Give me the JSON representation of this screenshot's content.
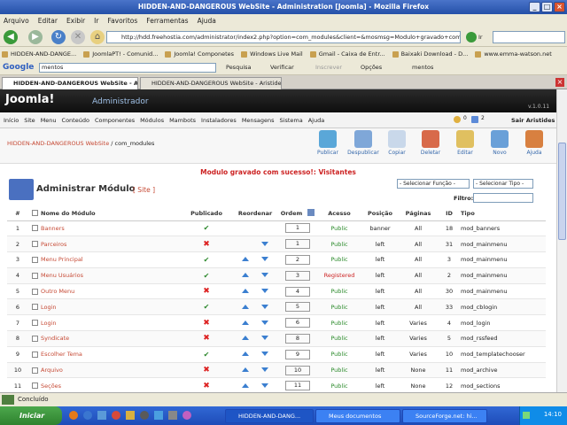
{
  "window": {
    "title": "HIDDEN-AND-DANGEROUS WebSite - Administration [Joomla] - Mozilla Firefox"
  },
  "menubar": [
    "Arquivo",
    "Editar",
    "Exibir",
    "Ir",
    "Favoritos",
    "Ferramentas",
    "Ajuda"
  ],
  "url": "http://hdd.freehostia.com/administrator/index2.php?option=com_modules&client=&mosmsg=Modulo+gravado+com+suce",
  "go_label": "Ir",
  "bookmarks": [
    "HIDDEN-AND-DANGE...",
    "JoomlaPT! - Comunid...",
    "Joomla! Componetes",
    "Windows Live Mail",
    "Gmail - Caixa de Entr...",
    "Baixaki Download - D...",
    "www.emma-watson.net"
  ],
  "google": {
    "label": "Google",
    "query": "mentos",
    "pesquisa": "Pesquisa",
    "verificar": "Verificar",
    "inscrever": "Inscrever",
    "opcoes": "Opções",
    "extra": "mentos"
  },
  "tabs": [
    "HIDDEN-AND-DANGEROUS WebSite - A...",
    "HIDDEN-AND-DANGEROUS WebSite - Aristides"
  ],
  "joomla": {
    "logo": "Joomla!",
    "subtitle": "Administrador",
    "version": "v.1.0.11",
    "user": "Sair Aristides",
    "counter1": "0",
    "counter2": "2"
  },
  "jmenu": [
    "Início",
    "Site",
    "Menu",
    "Conteúdo",
    "Componentes",
    "Módulos",
    "Mambots",
    "Instaladores",
    "Mensagens",
    "Sistema",
    "Ajuda"
  ],
  "breadcrumb": {
    "site": "HIDDEN-AND-DANGEROUS WebSite",
    "path": " / com_modules"
  },
  "toolbar": [
    "Publicar",
    "Despublicar",
    "Copiar",
    "Deletar",
    "Editar",
    "Novo",
    "Ajuda"
  ],
  "message": "Modulo gravado com sucesso!: Visitantes",
  "heading": {
    "title": "Administrar Módulo",
    "sub": "[ Site ]"
  },
  "filters": {
    "funcao": "- Selecionar Função -",
    "tipo": "- Selecionar Tipo -",
    "filtro_label": "Filtro:"
  },
  "columns": [
    "#",
    "",
    "Nome do Módulo",
    "Publicado",
    "Reordenar",
    "Ordem",
    "",
    "Acesso",
    "Posição",
    "Páginas",
    "ID",
    "Tipo"
  ],
  "rows": [
    {
      "n": "1",
      "name": "Banners",
      "pub": true,
      "up": false,
      "down": false,
      "order": "1",
      "access": "Public",
      "pos": "banner",
      "pages": "All",
      "id": "18",
      "type": "mod_banners"
    },
    {
      "n": "2",
      "name": "Parceiros",
      "pub": false,
      "up": false,
      "down": true,
      "order": "1",
      "access": "Public",
      "pos": "left",
      "pages": "All",
      "id": "31",
      "type": "mod_mainmenu"
    },
    {
      "n": "3",
      "name": "Menu Principal",
      "pub": true,
      "up": true,
      "down": true,
      "order": "2",
      "access": "Public",
      "pos": "left",
      "pages": "All",
      "id": "3",
      "type": "mod_mainmenu"
    },
    {
      "n": "4",
      "name": "Menu Usuários",
      "pub": true,
      "up": true,
      "down": true,
      "order": "3",
      "access": "Registered",
      "pos": "left",
      "pages": "All",
      "id": "2",
      "type": "mod_mainmenu"
    },
    {
      "n": "5",
      "name": "Outro Menu",
      "pub": false,
      "up": true,
      "down": true,
      "order": "4",
      "access": "Public",
      "pos": "left",
      "pages": "All",
      "id": "30",
      "type": "mod_mainmenu"
    },
    {
      "n": "6",
      "name": "Login",
      "pub": true,
      "up": true,
      "down": true,
      "order": "5",
      "access": "Public",
      "pos": "left",
      "pages": "All",
      "id": "33",
      "type": "mod_cblogin"
    },
    {
      "n": "7",
      "name": "Login",
      "pub": false,
      "up": true,
      "down": true,
      "order": "6",
      "access": "Public",
      "pos": "left",
      "pages": "Varies",
      "id": "4",
      "type": "mod_login"
    },
    {
      "n": "8",
      "name": "Syndicate",
      "pub": false,
      "up": true,
      "down": true,
      "order": "8",
      "access": "Public",
      "pos": "left",
      "pages": "Varies",
      "id": "5",
      "type": "mod_rssfeed"
    },
    {
      "n": "9",
      "name": "Escolher Tema",
      "pub": true,
      "up": true,
      "down": true,
      "order": "9",
      "access": "Public",
      "pos": "left",
      "pages": "Varies",
      "id": "10",
      "type": "mod_templatechooser"
    },
    {
      "n": "10",
      "name": "Arquivo",
      "pub": false,
      "up": true,
      "down": true,
      "order": "10",
      "access": "Public",
      "pos": "left",
      "pages": "None",
      "id": "11",
      "type": "mod_archive"
    },
    {
      "n": "11",
      "name": "Seções",
      "pub": false,
      "up": true,
      "down": true,
      "order": "11",
      "access": "Public",
      "pos": "left",
      "pages": "None",
      "id": "12",
      "type": "mod_sections"
    }
  ],
  "status": "Concluído",
  "taskbar": {
    "start": "Iniciar",
    "items": [
      "HIDDEN-AND-DANG...",
      "Meus documentos",
      "SourceForge.net: hi..."
    ],
    "clock": "14:10"
  }
}
